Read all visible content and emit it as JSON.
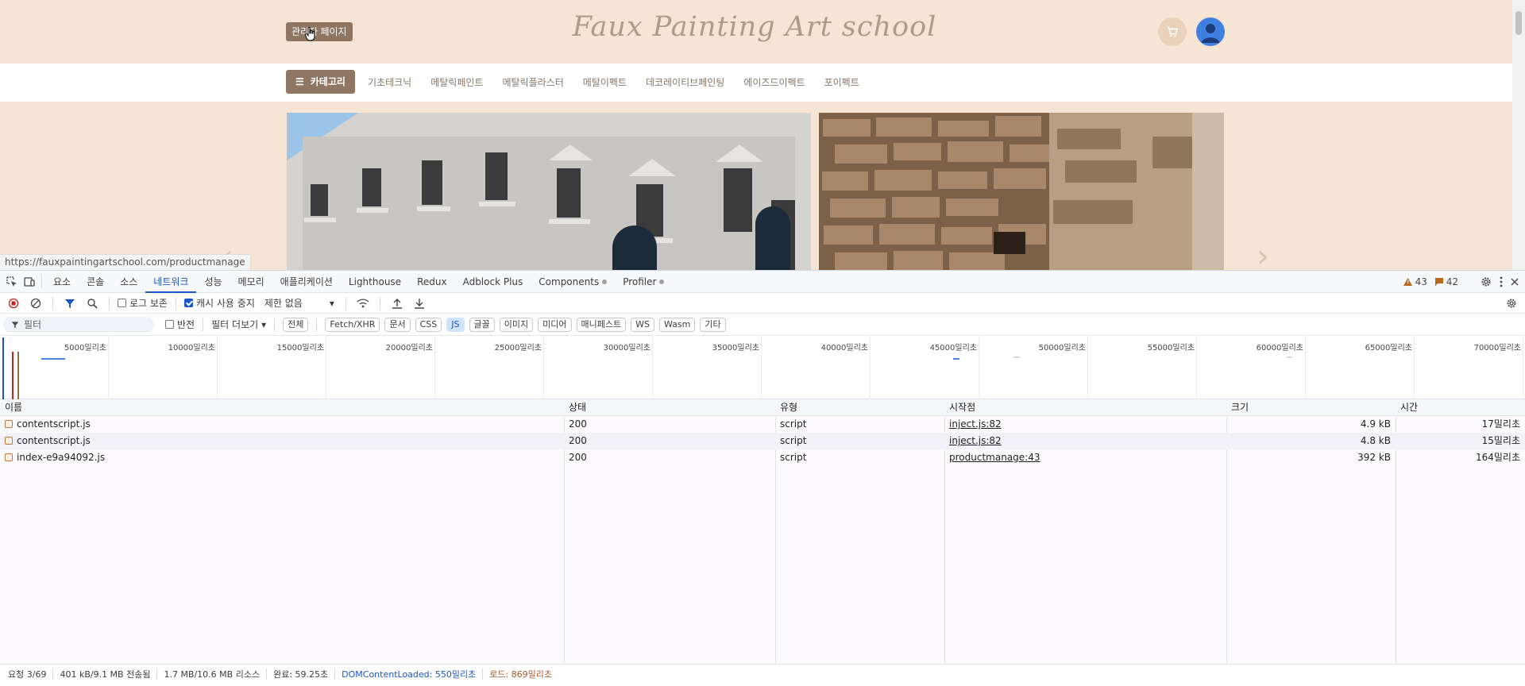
{
  "site": {
    "admin_button": "관리자 페이지",
    "brand": "Faux Painting Art school",
    "category_button": "카테고리",
    "nav_links": [
      "기초테크닉",
      "메탈릭페인트",
      "메탈릭플라스터",
      "메탈이펙트",
      "데코레이티브페인팅",
      "에이즈드이펙트",
      "포이펙트"
    ],
    "status_url": "https://fauxpaintingartschool.com/productmanage"
  },
  "devtools": {
    "tabs": [
      "요소",
      "콘솔",
      "소스",
      "네트워크",
      "성능",
      "메모리",
      "애플리케이션",
      "Lighthouse",
      "Redux",
      "Adblock Plus",
      "Components",
      "Profiler"
    ],
    "active_tab": "네트워크",
    "warnings": "43",
    "messages": "42",
    "toolbar": {
      "preserve_log": "로그 보존",
      "disable_cache": "캐시 사용 중지",
      "throttle": "제한 없음"
    },
    "filter": {
      "placeholder": "필터",
      "invert": "반전",
      "more_filters": "필터 더보기",
      "chips": [
        "전체",
        "Fetch/XHR",
        "문서",
        "CSS",
        "JS",
        "글꼴",
        "이미지",
        "미디어",
        "매니페스트",
        "WS",
        "Wasm",
        "기타"
      ],
      "active_chip": "JS"
    },
    "overview_ticks": [
      "5000밀리초",
      "10000밀리초",
      "15000밀리초",
      "20000밀리초",
      "25000밀리초",
      "30000밀리초",
      "35000밀리초",
      "40000밀리초",
      "45000밀리초",
      "50000밀리초",
      "55000밀리초",
      "60000밀리초",
      "65000밀리초",
      "70000밀리초"
    ],
    "columns": [
      "이름",
      "상태",
      "유형",
      "시작점",
      "크기",
      "시간"
    ],
    "rows": [
      {
        "name": "contentscript.js",
        "status": "200",
        "type": "script",
        "initiator": "inject.js:82",
        "size": "4.9 kB",
        "time": "17밀리초"
      },
      {
        "name": "contentscript.js",
        "status": "200",
        "type": "script",
        "initiator": "inject.js:82",
        "size": "4.8 kB",
        "time": "15밀리초"
      },
      {
        "name": "index-e9a94092.js",
        "status": "200",
        "type": "script",
        "initiator": "productmanage:43",
        "size": "392 kB",
        "time": "164밀리초"
      }
    ],
    "status": {
      "requests": "요청 3/69",
      "transferred": "401 kB/9.1 MB 전송됨",
      "resources": "1.7 MB/10.6 MB 리소스",
      "finish": "완료: 59.25초",
      "dom_loaded": "DOMContentLoaded: 550밀리초",
      "load": "로드: 869밀리초"
    }
  },
  "colors": {
    "site_bg": "#f6e5d4",
    "brand_button": "#8f7663",
    "devtools_accent": "#1a56c8"
  }
}
